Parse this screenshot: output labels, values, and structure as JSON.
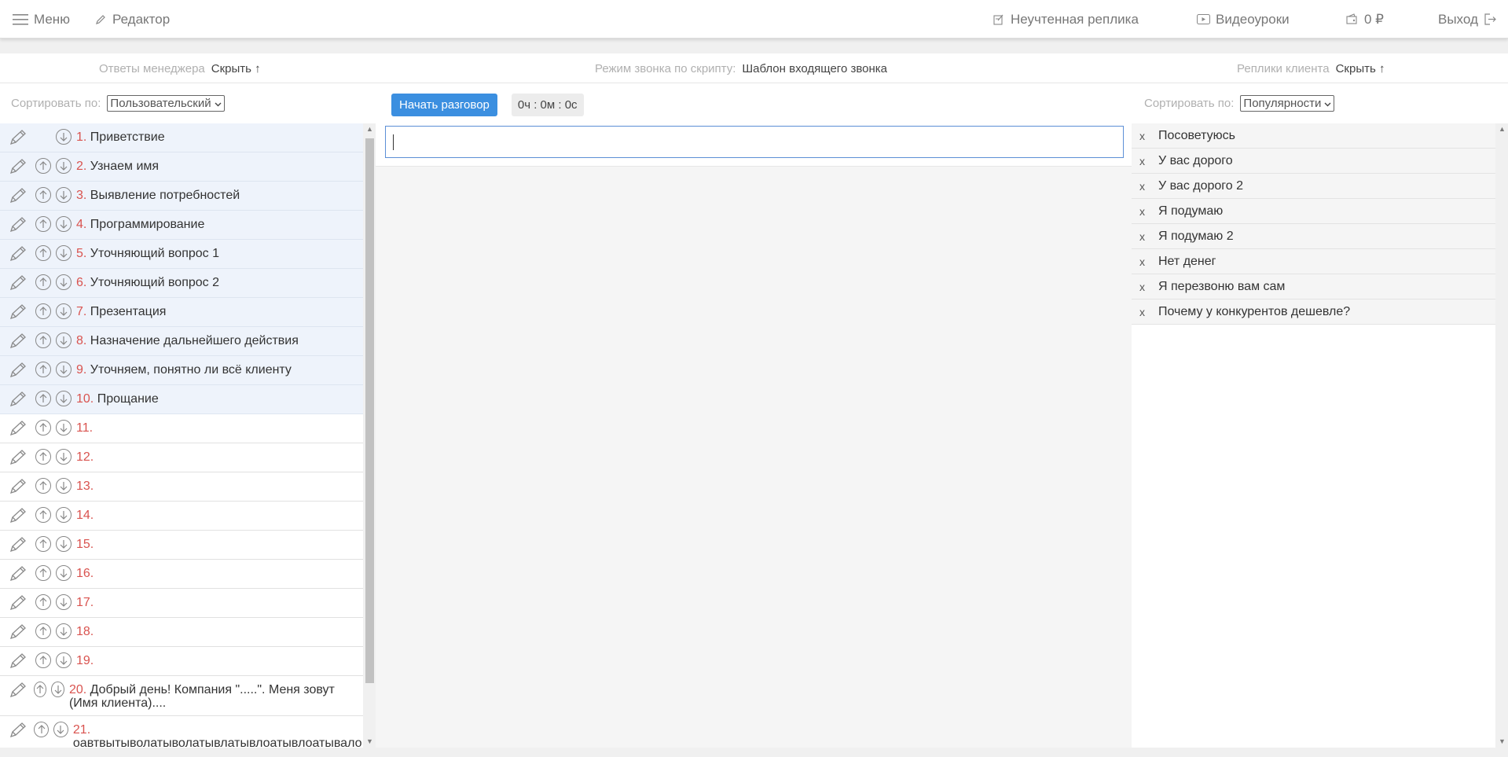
{
  "topbar": {
    "menu_label": "Меню",
    "editor_label": "Редактор",
    "unaccounted_label": "Неучтенная реплика",
    "video_label": "Видеоуроки",
    "balance_label": "0 ₽",
    "logout_label": "Выход"
  },
  "subhead": {
    "manager_answers_label": "Ответы менеджера",
    "manager_hide_label": "Скрыть ↑",
    "mode_label": "Режим звонка по скрипту:",
    "mode_value": "Шаблон входящего звонка",
    "client_replies_label": "Реплики клиента",
    "client_hide_label": "Скрыть ↑"
  },
  "left": {
    "sort_label": "Сортировать по:",
    "sort_value": "Пользовательский",
    "items": [
      {
        "num": "1.",
        "text": "Приветствие",
        "filled": true,
        "up": false
      },
      {
        "num": "2.",
        "text": "Узнаем имя",
        "filled": true,
        "up": true
      },
      {
        "num": "3.",
        "text": "Выявление потребностей",
        "filled": true,
        "up": true
      },
      {
        "num": "4.",
        "text": "Программирование",
        "filled": true,
        "up": true
      },
      {
        "num": "5.",
        "text": "Уточняющий вопрос 1",
        "filled": true,
        "up": true
      },
      {
        "num": "6.",
        "text": "Уточняющий вопрос 2",
        "filled": true,
        "up": true
      },
      {
        "num": "7.",
        "text": "Презентация",
        "filled": true,
        "up": true
      },
      {
        "num": "8.",
        "text": "Назначение дальнейшего действия",
        "filled": true,
        "up": true
      },
      {
        "num": "9.",
        "text": "Уточняем, понятно ли всё клиенту",
        "filled": true,
        "up": true
      },
      {
        "num": "10.",
        "text": "Прощание",
        "filled": true,
        "up": true
      },
      {
        "num": "11.",
        "text": "",
        "filled": false,
        "up": true
      },
      {
        "num": "12.",
        "text": "",
        "filled": false,
        "up": true
      },
      {
        "num": "13.",
        "text": "",
        "filled": false,
        "up": true
      },
      {
        "num": "14.",
        "text": "",
        "filled": false,
        "up": true
      },
      {
        "num": "15.",
        "text": "",
        "filled": false,
        "up": true
      },
      {
        "num": "16.",
        "text": "",
        "filled": false,
        "up": true
      },
      {
        "num": "17.",
        "text": "",
        "filled": false,
        "up": true
      },
      {
        "num": "18.",
        "text": "",
        "filled": false,
        "up": true
      },
      {
        "num": "19.",
        "text": "",
        "filled": false,
        "up": true
      },
      {
        "num": "20.",
        "text": "Добрый день! Компания \".....\". Меня зовут (Имя клиента)....",
        "filled": false,
        "up": true,
        "tall": true
      },
      {
        "num": "21.",
        "text": "оавтвытыволатыволатывлатывлоатывлоатывало",
        "filled": false,
        "up": true,
        "tall": true
      }
    ]
  },
  "center": {
    "start_button": "Начать разговор",
    "timer": "0ч : 0м : 0с",
    "input_value": ""
  },
  "right": {
    "sort_label": "Сортировать по:",
    "sort_value": "Популярности",
    "items": [
      "Посоветуюсь",
      "У вас дорого",
      "У вас дорого 2",
      "Я подумаю",
      "Я подумаю 2",
      "Нет денег",
      "Я перезвоню вам сам",
      "Почему у конкурентов дешевле?"
    ]
  },
  "colors": {
    "accent": "#3b8fe0",
    "number_red": "#d9534f",
    "filled_row": "#eef3fb"
  }
}
